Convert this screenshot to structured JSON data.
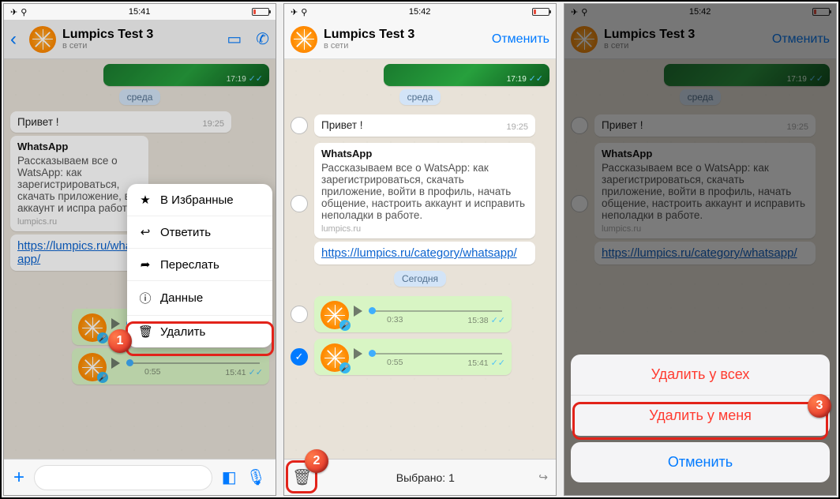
{
  "statusbar": {
    "time1": "15:41",
    "time2": "15:42",
    "time3": "15:42"
  },
  "header": {
    "title": "Lumpics Test 3",
    "subtitle": "в сети",
    "cancel": "Отменить"
  },
  "chat": {
    "topimg_time": "17:19",
    "day1": "среда",
    "day2": "Сегодня",
    "greet": "Привет !",
    "greet_time": "19:25",
    "article": {
      "title": "WhatsApp",
      "body_short": "Рассказываем все о WatsApp: как зарегистрироваться, скачать приложение, во",
      "body_crop": "аккаунт и испра работе.",
      "body_full": "Рассказываем все о WatsApp: как зарегистрироваться, скачать приложение, войти в профиль, начать общение, настроить аккаунт и исправить неполадки в работе.",
      "footer": "lumpics.ru"
    },
    "link_short": "https://lumpics.ru/whatsapp/",
    "link_long": "https://lumpics.ru/category/whatsapp/",
    "voice1": {
      "dur": "0:33",
      "time": "15:38"
    },
    "voice2": {
      "dur": "0:55",
      "time": "15:41"
    }
  },
  "ctx": {
    "star": "В Избранные",
    "reply": "Ответить",
    "forward": "Переслать",
    "info": "Данные",
    "delete": "Удалить"
  },
  "selbar": {
    "label": "Выбрано: 1"
  },
  "sheet": {
    "all": "Удалить у всех",
    "me": "Удалить у меня",
    "cancel": "Отменить"
  },
  "badges": {
    "b1": "1",
    "b2": "2",
    "b3": "3"
  }
}
